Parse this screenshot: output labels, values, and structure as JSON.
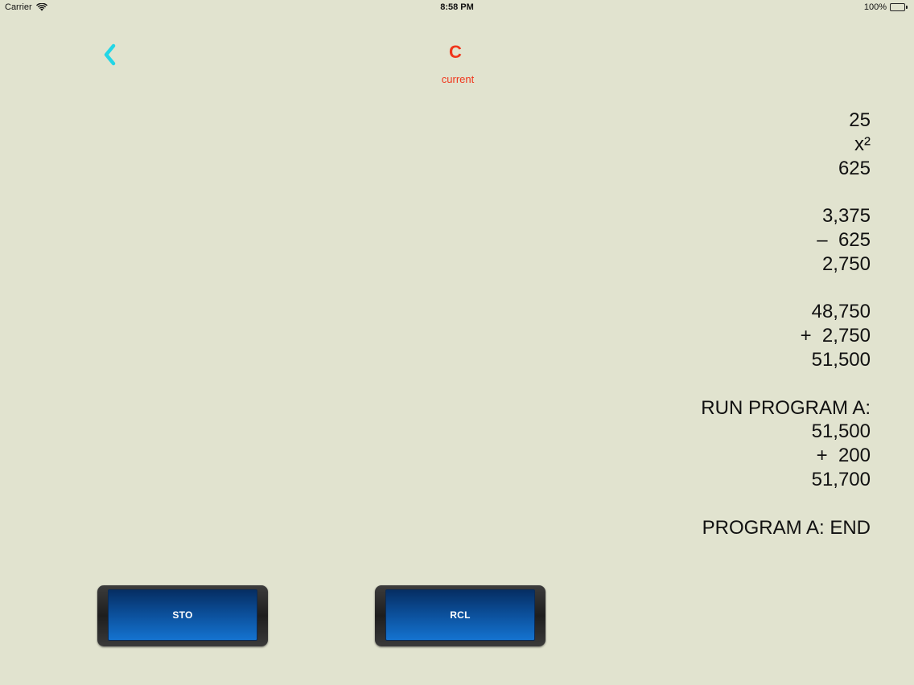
{
  "status_bar": {
    "carrier": "Carrier",
    "time": "8:58 PM",
    "battery_percent": "100%",
    "wifi_icon": "wifi-icon",
    "battery_icon": "battery-icon",
    "battery_level": 1.0,
    "battery_color": "#4cd964"
  },
  "nav": {
    "back_icon": "chevron-left-icon",
    "back_color": "#23d6e6",
    "title": "C",
    "subtitle": "current",
    "title_color": "#f0361c"
  },
  "tape": {
    "lines": [
      "25",
      "x²",
      "625",
      "",
      "3,375",
      "–  625",
      "2,750",
      "",
      "48,750",
      "+  2,750",
      "51,500",
      "",
      "RUN PROGRAM A:",
      "51,500",
      "+  200",
      "51,700",
      "",
      "PROGRAM A: END"
    ]
  },
  "keys": {
    "sto_label": "STO",
    "rcl_label": "RCL"
  },
  "colors": {
    "background": "#e1e3cf",
    "key_blue": "#0b4d97"
  }
}
